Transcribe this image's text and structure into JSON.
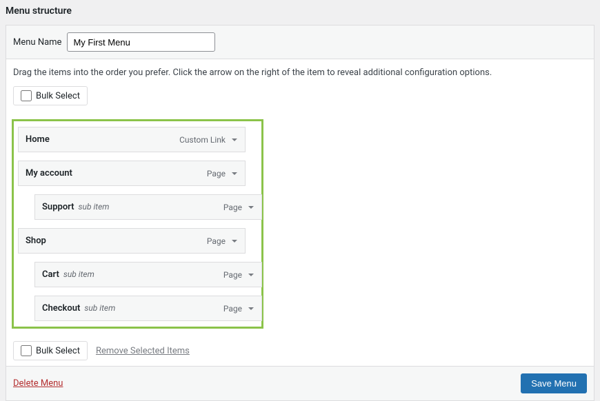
{
  "heading": "Menu structure",
  "menu_name": {
    "label": "Menu Name",
    "value": "My First Menu"
  },
  "instructions": "Drag the items into the order you prefer. Click the arrow on the right of the item to reveal additional configuration options.",
  "bulk_select_label": "Bulk Select",
  "remove_selected_label": "Remove Selected Items",
  "delete_menu_label": "Delete Menu",
  "save_menu_label": "Save Menu",
  "sub_item_hint": "sub item",
  "items": [
    {
      "title": "Home",
      "type": "Custom Link",
      "depth": 0
    },
    {
      "title": "My account",
      "type": "Page",
      "depth": 0
    },
    {
      "title": "Support",
      "type": "Page",
      "depth": 1
    },
    {
      "title": "Shop",
      "type": "Page",
      "depth": 0
    },
    {
      "title": "Cart",
      "type": "Page",
      "depth": 1
    },
    {
      "title": "Checkout",
      "type": "Page",
      "depth": 1
    }
  ]
}
